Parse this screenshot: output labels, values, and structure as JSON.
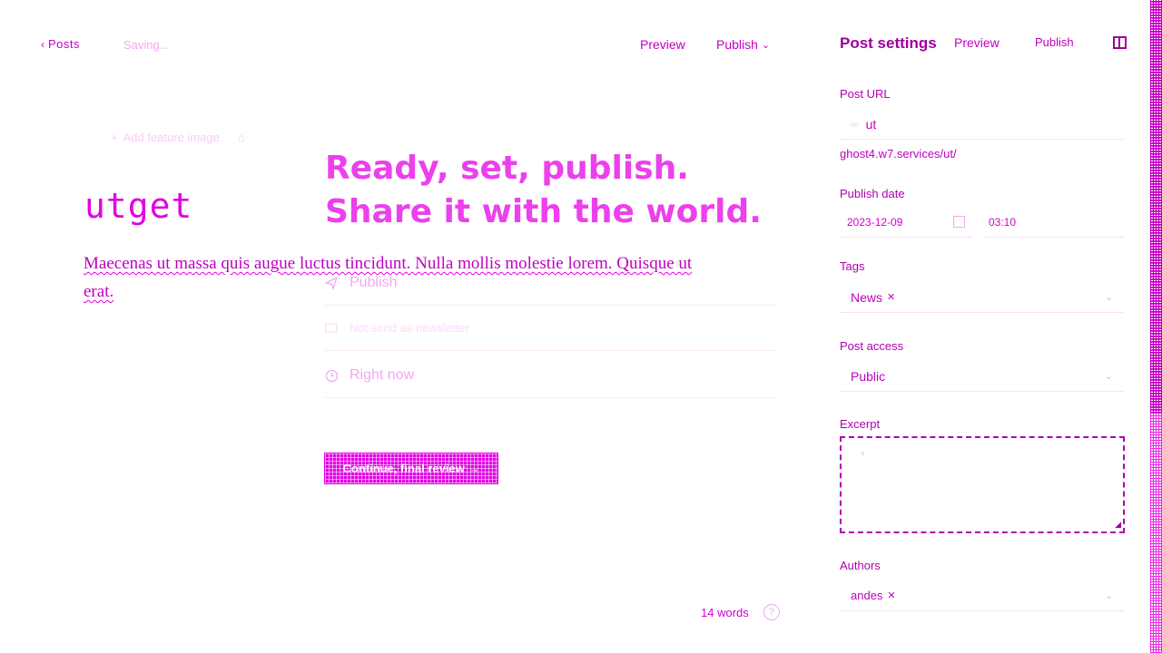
{
  "topbar": {
    "back_label": "Posts",
    "status": "Saving...",
    "preview_label": "Preview",
    "publish_label": "Publish"
  },
  "editor": {
    "feature_image_label": "Add feature image",
    "title": "utget",
    "body": "Maecenas ut massa quis augue luctus tincidunt. Nulla mollis molestie lorem. Quisque ut erat.",
    "word_count": "14 words"
  },
  "publish_flow": {
    "headline_line1": "Ready, set, publish.",
    "headline_line2": "Share it with the world.",
    "option_publish": "Publish",
    "option_newsletter": "Not send as newsletter",
    "option_time": "Right now",
    "continue_label": "Continue, final review →"
  },
  "sidebar": {
    "title": "Post settings",
    "preview_label": "Preview",
    "publish_label": "Publish",
    "post_url_label": "Post URL",
    "post_url_value": "ut",
    "post_url_full": "ghost4.w7.services/ut/",
    "publish_date_label": "Publish date",
    "publish_date_value": "2023-12-09",
    "publish_time_value": "03:10",
    "tags_label": "Tags",
    "tag_value": "News",
    "post_access_label": "Post access",
    "post_access_value": "Public",
    "excerpt_label": "Excerpt",
    "authors_label": "Authors",
    "author_value": "andes"
  },
  "colors": {
    "accent": "#e100e1",
    "accent_dark": "#9d009d",
    "muted": "#f2a8f2"
  },
  "icons": [
    "chevron-left-icon",
    "chevron-down-icon",
    "image-icon",
    "link-icon",
    "calendar-icon",
    "clock-icon",
    "send-icon",
    "mail-icon",
    "close-icon",
    "help-icon",
    "sidebar-toggle-icon",
    "resize-grip-icon"
  ]
}
